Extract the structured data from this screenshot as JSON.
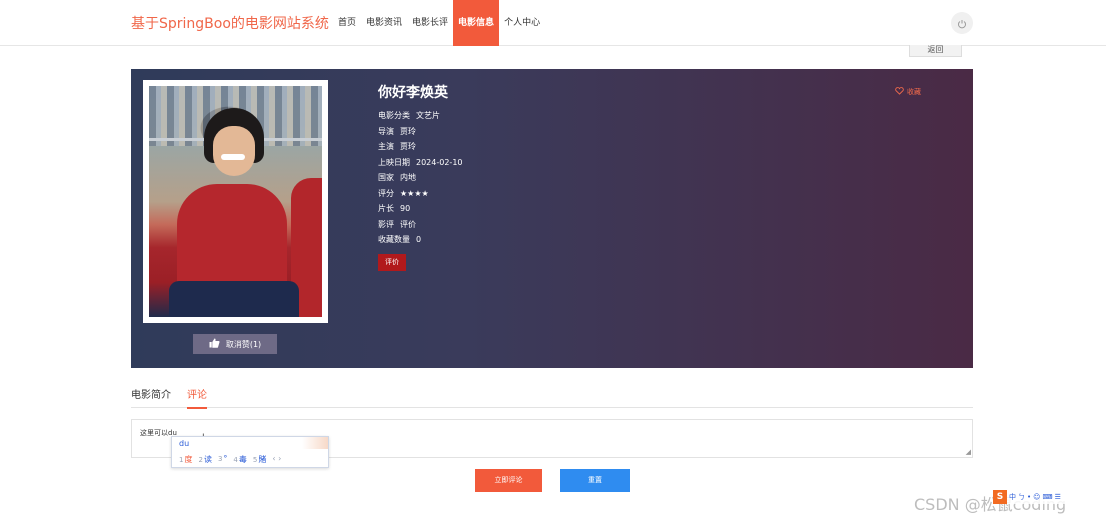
{
  "header": {
    "brand": "基于SpringBoo的电影网站系统",
    "nav": [
      "首页",
      "电影资讯",
      "电影长评",
      "电影信息",
      "个人中心"
    ],
    "active_nav": "电影信息"
  },
  "back_label": "返回",
  "movie": {
    "title": "你好李焕英",
    "favorite_label": "收藏",
    "info": [
      {
        "key": "电影分类",
        "value": "文艺片"
      },
      {
        "key": "导演",
        "value": "贾玲"
      },
      {
        "key": "主演",
        "value": "贾玲"
      },
      {
        "key": "上映日期",
        "value": "2024-02-10"
      },
      {
        "key": "国家",
        "value": "内地"
      },
      {
        "key": "评分",
        "value": "★★★★"
      },
      {
        "key": "片长",
        "value": "90"
      },
      {
        "key": "影评",
        "value": "评价"
      },
      {
        "key": "收藏数量",
        "value": "0"
      }
    ],
    "rate_button": "评价",
    "like_button": "取消赞(1)"
  },
  "tabs": [
    "电影简介",
    "评论"
  ],
  "active_tab": "评论",
  "comment": {
    "value": "这里可以du",
    "grip": "◢"
  },
  "ime": {
    "pinyin": "du",
    "candidates": [
      {
        "n": "1",
        "w": "度"
      },
      {
        "n": "2",
        "w": "读"
      },
      {
        "n": "3",
        "w": "°"
      },
      {
        "n": "4",
        "w": "毒"
      },
      {
        "n": "5",
        "w": "賭"
      }
    ],
    "nav": "‹ ›"
  },
  "buttons": {
    "submit": "立即评论",
    "reset": "重置"
  },
  "watermark": "CSDN @松鼠coding",
  "tray": {
    "logo": "S",
    "items": [
      "中",
      "ㄅ",
      "•",
      "☺",
      "⌨",
      "☰"
    ]
  },
  "colors": {
    "accent": "#f25a3b",
    "brand": "#f0674a",
    "reset": "#2f8cf0",
    "rate": "#b1191c"
  },
  "icons": [
    "power-icon",
    "heart-icon",
    "thumbs-up-icon"
  ]
}
